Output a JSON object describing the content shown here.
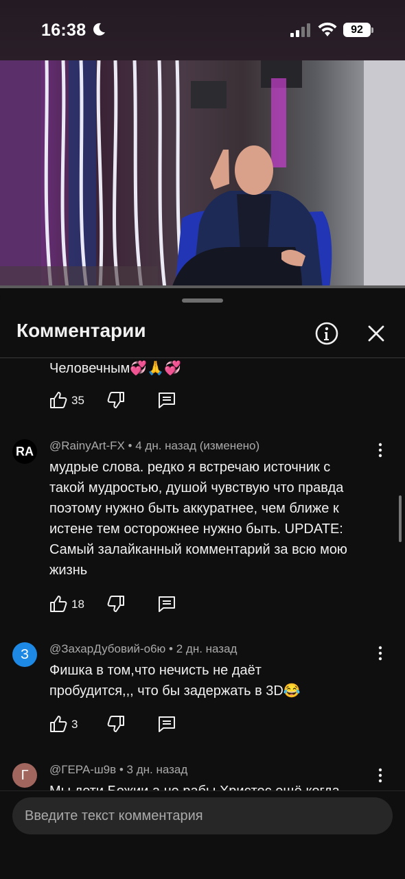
{
  "status_bar": {
    "time": "16:38",
    "battery": "92"
  },
  "sheet": {
    "title": "Комментарии"
  },
  "comments": [
    {
      "text": "Человечным💞🙏💞",
      "likes": "35"
    },
    {
      "author": "@RainyArt-FX",
      "age": "4 дн. назад (изменено)",
      "avatar_text": "RA",
      "avatar_color": "#000000",
      "lines": [
        "мудрые слова. редко я встречаю источник с",
        "такой мудростью, душой чувствую что правда",
        "поэтому нужно быть аккуратнее, чем ближе к",
        "истене тем осторожнее нужно быть.  UPDATE:",
        "Самый залайканный комментарий за всю мою",
        "жизнь"
      ],
      "likes": "18"
    },
    {
      "author": "@ЗахарДубовий-о6ю",
      "age": "2 дн. назад",
      "avatar_text": "З",
      "avatar_color": "#1e88e5",
      "lines": [
        "Фишка в том,что нечисть не даёт",
        "пробудится,,, что бы задержать в 3D😂"
      ],
      "likes": "3"
    },
    {
      "author": "@ГЕРА-ш9в",
      "age": "3 дн. назад",
      "avatar_text": "Г",
      "avatar_color": "#a1665e",
      "lines": [
        "Мы дети Божии а не рабы Христос ещё когда"
      ]
    }
  ],
  "input": {
    "placeholder": "Введите текст комментария"
  },
  "icons": [
    "moon-icon",
    "signal-icon",
    "wifi-icon",
    "info-icon",
    "close-icon",
    "like-icon",
    "dislike-icon",
    "reply-icon",
    "more-icon"
  ]
}
